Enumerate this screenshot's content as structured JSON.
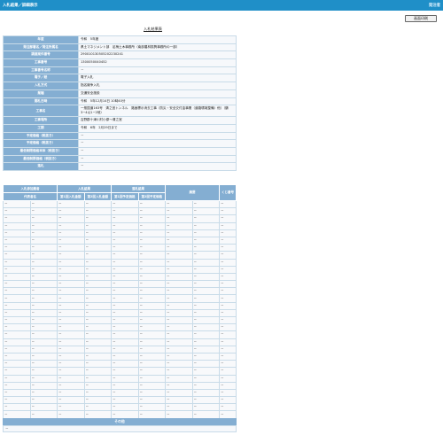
{
  "header": {
    "title": "入札結果／詳細表示",
    "right_text": "発注者"
  },
  "print_button": "画面印刷",
  "result_title": "入札結果表",
  "info_rows": [
    {
      "label": "年度",
      "value": "令和　5年度"
    },
    {
      "label": "発注部署名／発注所属名",
      "value": "県土マネジメント部　足柄土木事務所（南部農林振興事務所の一部）"
    },
    {
      "label": "調達案件番号",
      "value": "290010130505202230241"
    },
    {
      "label": "工事番号",
      "value": "1300050040452"
    },
    {
      "label": "工事番号名称",
      "value": "－"
    },
    {
      "label": "電子／紙",
      "value": "電子入札"
    },
    {
      "label": "入札方式",
      "value": "指名競争入札"
    },
    {
      "label": "業種",
      "value": "交通安全施設"
    },
    {
      "label": "開札日時",
      "value": "令和　5年12月14日 10時40分"
    },
    {
      "label": "工事名",
      "value": "一般国道163号　清之宮トンネル　路面標示消去工事（防災・安全交付金事業（道路環境整備）他）（鶴3−4以1−2他）",
      "tall": true
    },
    {
      "label": "工事場所",
      "value": "吉野郡十津川村小原～清之宮"
    },
    {
      "label": "工期",
      "value": "令和　6年　2月29日まで"
    },
    {
      "label": "予定価格（税抜き）",
      "value": "－"
    },
    {
      "label": "予定価格（税抜き）",
      "value": "－"
    },
    {
      "label": "最低制限価格本体（税抜き）",
      "value": "－"
    },
    {
      "label": "最低制限価格（税抜き）",
      "value": "－"
    },
    {
      "label": "落札",
      "value": "－"
    }
  ],
  "bid_table": {
    "group_headers": [
      "入札参加業者",
      "入札結果",
      "落札結果",
      "摘要",
      "くじ番号"
    ],
    "sub_headers": [
      "代表者名",
      "第1回入札金額",
      "第2回入札金額",
      "第1回予定価格",
      "第2回予定価格"
    ],
    "row_value": "－"
  },
  "sonota": {
    "title": "その他",
    "value": "－"
  }
}
